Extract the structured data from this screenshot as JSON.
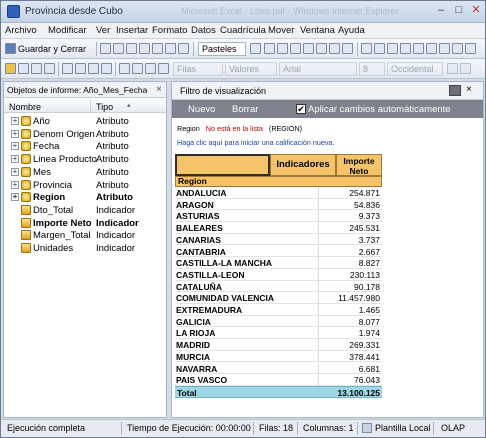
{
  "window": {
    "title": "Provincia desde Cubo",
    "ghost_title": "Microsoft Excel - Libro.pdf - Windows Internet Explorer",
    "min": "–",
    "max": "□",
    "close": "✕"
  },
  "menu": [
    "Archivo",
    "Modificar",
    "Ver",
    "Insertar",
    "Formato",
    "Datos",
    "Cuadrícula",
    "Mover",
    "Ventana",
    "Ayuda"
  ],
  "toolbar1": {
    "save_label": "Guardar y Cerrar",
    "style_combo": "Pasteles"
  },
  "toolbar2": {
    "rows_combo": "Filas",
    "values_combo": "Valores",
    "font_combo": "Arial",
    "size_combo": "8",
    "theme_combo": "Occidental"
  },
  "left_panel": {
    "title": "Objetos de informe: Año_Mes_Fecha_Re",
    "close": "×",
    "col_name": "Nombre",
    "col_type": "Tipo",
    "items": [
      {
        "name": "Año",
        "type": "Atributo",
        "kind": "attr",
        "bold": false
      },
      {
        "name": "Denom Origen",
        "type": "Atributo",
        "kind": "attr",
        "bold": false
      },
      {
        "name": "Fecha",
        "type": "Atributo",
        "kind": "attr",
        "bold": false
      },
      {
        "name": "Linea Producto",
        "type": "Atributo",
        "kind": "attr",
        "bold": false
      },
      {
        "name": "Mes",
        "type": "Atributo",
        "kind": "attr",
        "bold": false
      },
      {
        "name": "Provincia",
        "type": "Atributo",
        "kind": "attr",
        "bold": false
      },
      {
        "name": "Region",
        "type": "Atributo",
        "kind": "attr",
        "bold": true
      },
      {
        "name": "Dto_Total",
        "type": "Indicador",
        "kind": "ind",
        "bold": false
      },
      {
        "name": "Importe Neto",
        "type": "Indicador",
        "kind": "ind",
        "bold": true
      },
      {
        "name": "Margen_Total",
        "type": "Indicador",
        "kind": "ind",
        "bold": false
      },
      {
        "name": "Unidades",
        "type": "Indicador",
        "kind": "ind",
        "bold": false
      }
    ]
  },
  "filter_panel": {
    "title": "Filtro de visualización",
    "new_label": "Nuevo",
    "clear_label": "Borrar",
    "auto_apply_label": "Aplicar cambios automáticamente",
    "auto_apply_checked": "✔",
    "condition_field": "Region",
    "condition_op": "No está en la lista",
    "condition_value": "(REGION)",
    "hint": "Haga clic aquí para iniciar una calificación nueva."
  },
  "grid": {
    "metrics_header": "Indicadores",
    "measure_header_line1": "Importe",
    "measure_header_line2": "Neto",
    "row_header": "Region",
    "rows": [
      {
        "region": "ANDALUCIA",
        "value": "254.871"
      },
      {
        "region": "ARAGON",
        "value": "54.836"
      },
      {
        "region": "ASTURIAS",
        "value": "9.373"
      },
      {
        "region": "BALEARES",
        "value": "245.531"
      },
      {
        "region": "CANARIAS",
        "value": "3.737"
      },
      {
        "region": "CANTABRIA",
        "value": "2.667"
      },
      {
        "region": "CASTILLA-LA MANCHA",
        "value": "8.827"
      },
      {
        "region": "CASTILLA-LEON",
        "value": "230.113"
      },
      {
        "region": "CATALUÑA",
        "value": "90.178"
      },
      {
        "region": "COMUNIDAD VALENCIA",
        "value": "11.457.980"
      },
      {
        "region": "EXTREMADURA",
        "value": "1.465"
      },
      {
        "region": "GALICIA",
        "value": "8.077"
      },
      {
        "region": "LA RIOJA",
        "value": "1.974"
      },
      {
        "region": "MADRID",
        "value": "269.331"
      },
      {
        "region": "MURCIA",
        "value": "378.441"
      },
      {
        "region": "NAVARRA",
        "value": "6.681"
      },
      {
        "region": "PAIS VASCO",
        "value": "76.043"
      }
    ],
    "total_label": "Total",
    "total_value": "13.100.125"
  },
  "status": {
    "state": "Ejecución completa",
    "time": "Tiempo de Ejecución: 00:00:00",
    "rows": "Filas: 18",
    "cols": "Columnas: 1",
    "template": "Plantilla Local",
    "mode": "OLAP"
  }
}
